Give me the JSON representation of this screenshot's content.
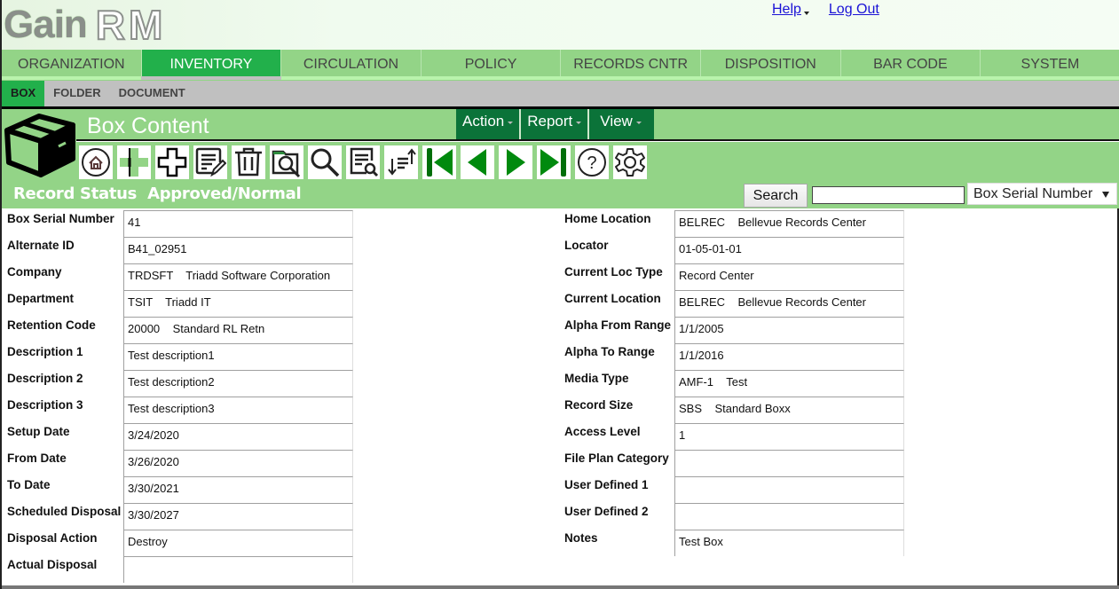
{
  "logo": {
    "part1": "Gain",
    "part2": "RM"
  },
  "top_links": {
    "help": "Help",
    "logout": "Log Out"
  },
  "nav": {
    "active": "INVENTORY",
    "items": [
      "ORGANIZATION",
      "INVENTORY",
      "CIRCULATION",
      "POLICY",
      "RECORDS CNTR",
      "DISPOSITION",
      "BAR CODE",
      "SYSTEM"
    ]
  },
  "subnav": {
    "active": "BOX",
    "items": [
      "BOX",
      "FOLDER",
      "DOCUMENT"
    ]
  },
  "panel": {
    "title": "Box Content",
    "menus": [
      "Action",
      "Report",
      "View"
    ],
    "toolbar": [
      "home-icon",
      "add-similar-icon",
      "add-new-icon",
      "edit-icon",
      "delete-icon",
      "browse-folder-icon",
      "search-icon",
      "query-icon",
      "sort-icon",
      "first-record-icon",
      "previous-record-icon",
      "next-record-icon",
      "last-record-icon",
      "help-icon",
      "settings-icon"
    ],
    "status_label": "Record Status",
    "status_value": "Approved/Normal",
    "search_button": "Search",
    "search_value": "",
    "search_field": "Box Serial Number"
  },
  "form": {
    "left": [
      {
        "label": "Box Serial Number",
        "value": "41"
      },
      {
        "label": "Alternate ID",
        "value": "B41_02951"
      },
      {
        "label": "Company",
        "value": "TRDSFT    Triadd Software Corporation"
      },
      {
        "label": "Department",
        "value": "TSIT    Triadd IT"
      },
      {
        "label": "Retention Code",
        "value": "20000    Standard RL Retn"
      },
      {
        "label": "Description 1",
        "value": "Test description1"
      },
      {
        "label": "Description 2",
        "value": "Test description2"
      },
      {
        "label": "Description 3",
        "value": "Test description3"
      },
      {
        "label": "Setup Date",
        "value": "3/24/2020"
      },
      {
        "label": "From Date",
        "value": "3/26/2020"
      },
      {
        "label": "To Date",
        "value": "3/30/2021"
      },
      {
        "label": "Scheduled Disposal",
        "value": "3/30/2027"
      },
      {
        "label": "Disposal Action",
        "value": "Destroy"
      },
      {
        "label": "Actual Disposal",
        "value": ""
      }
    ],
    "right": [
      {
        "label": "Home Location",
        "value": "BELREC    Bellevue Records Center"
      },
      {
        "label": "Locator",
        "value": "01-05-01-01"
      },
      {
        "label": "Current Loc Type",
        "value": "Record Center"
      },
      {
        "label": "Current Location",
        "value": "BELREC    Bellevue Records Center"
      },
      {
        "label": "Alpha From Range",
        "value": "1/1/2005"
      },
      {
        "label": "Alpha To Range",
        "value": "1/1/2016"
      },
      {
        "label": "Media Type",
        "value": "AMF-1    Test"
      },
      {
        "label": "Record Size",
        "value": "SBS    Standard Boxx"
      },
      {
        "label": "Access Level",
        "value": "1"
      },
      {
        "label": "File Plan Category",
        "value": ""
      },
      {
        "label": "User Defined 1",
        "value": ""
      },
      {
        "label": "User Defined 2",
        "value": ""
      },
      {
        "label": "Notes",
        "value": "Test Box"
      }
    ]
  },
  "colors": {
    "nav_bg": "#93d487",
    "nav_active": "#22b04b",
    "menu_bg": "#0b7339",
    "link": "#1a12d6"
  }
}
